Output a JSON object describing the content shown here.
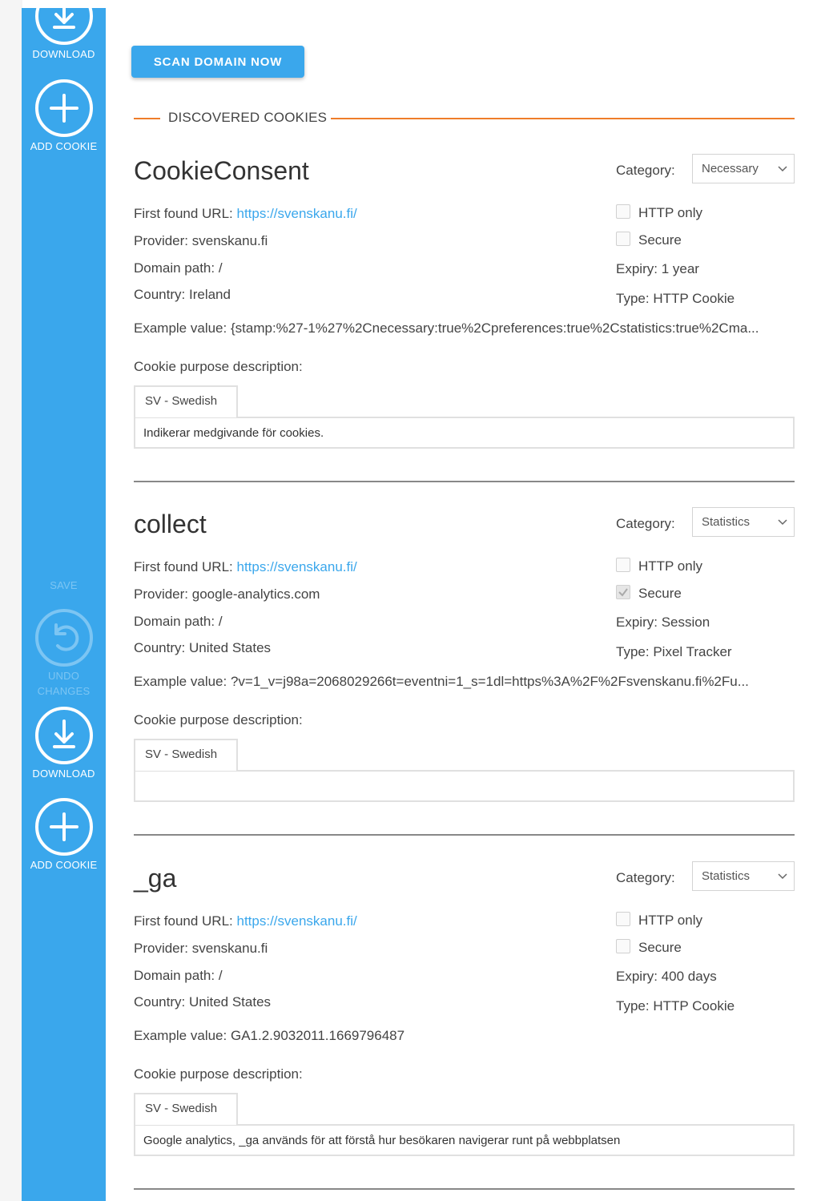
{
  "sidebar": {
    "items": [
      {
        "label": "DOWNLOAD",
        "icon": "download-icon"
      },
      {
        "label": "ADD COOKIE",
        "icon": "plus-icon"
      },
      {
        "label": "SAVE",
        "icon": ""
      },
      {
        "label": "UNDO CHANGES",
        "icon": "undo-icon"
      },
      {
        "label": "DOWNLOAD",
        "icon": "download-icon"
      },
      {
        "label": "ADD COOKIE",
        "icon": "plus-icon"
      }
    ]
  },
  "toolbar": {
    "scan_label": "SCAN DOMAIN NOW"
  },
  "section": {
    "title": "DISCOVERED COOKIES"
  },
  "labels": {
    "category": "Category:",
    "first_found": "First found URL:",
    "provider": "Provider:",
    "domain_path": "Domain path:",
    "country": "Country:",
    "http_only": "HTTP only",
    "secure": "Secure",
    "expiry": "Expiry:",
    "type": "Type:",
    "example": "Example value:",
    "purpose": "Cookie purpose description:"
  },
  "cookies": [
    {
      "name": "CookieConsent",
      "category": "Necessary",
      "url": "https://svenskanu.fi/",
      "provider": "svenskanu.fi",
      "domain_path": "/",
      "country": "Ireland",
      "http_only": false,
      "secure": false,
      "expiry": "1 year",
      "type": "HTTP Cookie",
      "example": "{stamp:%27-1%27%2Cnecessary:true%2Cpreferences:true%2Cstatistics:true%2Cma...",
      "lang": "SV - Swedish",
      "description": "Indikerar medgivande för cookies."
    },
    {
      "name": "collect",
      "category": "Statistics",
      "url": "https://svenskanu.fi/",
      "provider": "google-analytics.com",
      "domain_path": "/",
      "country": "United States",
      "http_only": false,
      "secure": true,
      "expiry": "Session",
      "type": "Pixel Tracker",
      "example": "?v=1_v=j98a=2068029266t=eventni=1_s=1dl=https%3A%2F%2Fsvenskanu.fi%2Fu...",
      "lang": "SV - Swedish",
      "description": ""
    },
    {
      "name": "_ga",
      "category": "Statistics",
      "url": "https://svenskanu.fi/",
      "provider": "svenskanu.fi",
      "domain_path": "/",
      "country": "United States",
      "http_only": false,
      "secure": false,
      "expiry": "400 days",
      "type": "HTTP Cookie",
      "example": "GA1.2.9032011.1669796487",
      "lang": "SV - Swedish",
      "description": "Google analytics, _ga används för att förstå hur besökaren navigerar runt på webbplatsen"
    }
  ],
  "colors": {
    "accent": "#3aa7ec",
    "orange": "#ef7d2a",
    "disabled": "#7cc5f3"
  }
}
